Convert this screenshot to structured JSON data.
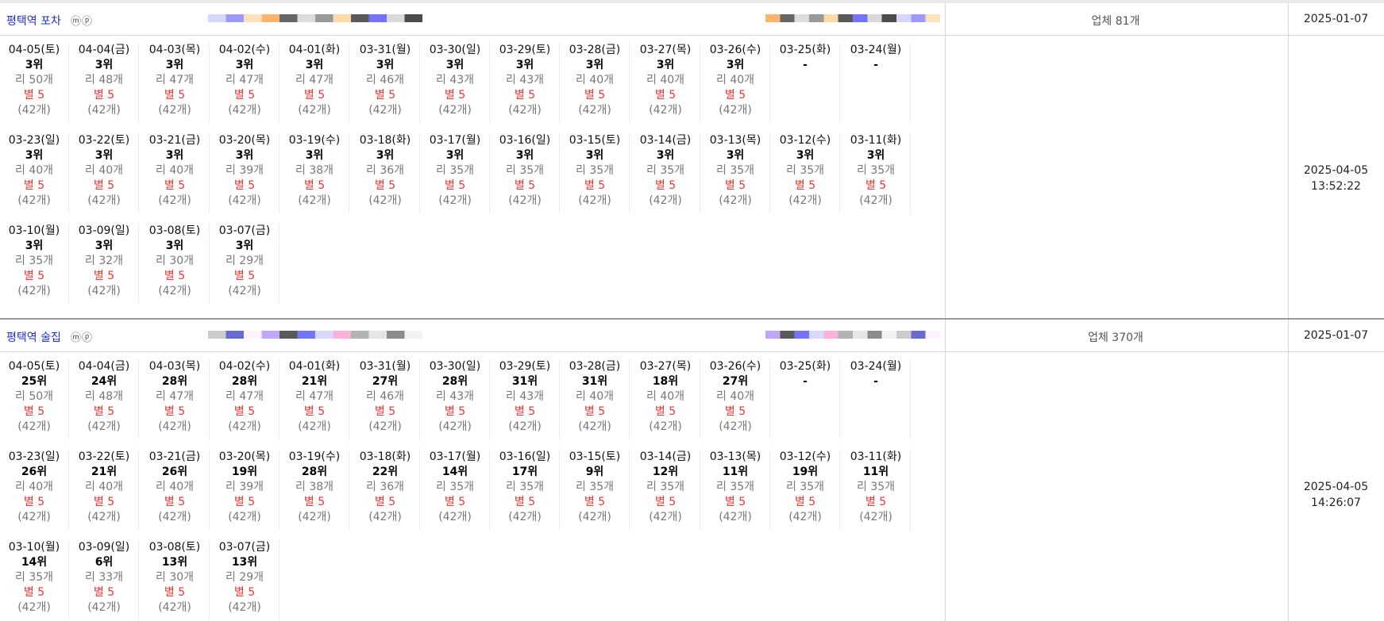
{
  "blocks": [
    {
      "keyword": "평택역 포차",
      "badges": "ⓜⓟ",
      "count_label": "업체 81개",
      "created_date": "2025-01-07",
      "updated_date": "2025-04-05",
      "updated_time": "13:52:22",
      "days": [
        {
          "date": "04-05(토)",
          "rank": "3위",
          "reviews": "리 50개",
          "star": "별 5",
          "star_count": "(42개)"
        },
        {
          "date": "04-04(금)",
          "rank": "3위",
          "reviews": "리 48개",
          "star": "별 5",
          "star_count": "(42개)"
        },
        {
          "date": "04-03(목)",
          "rank": "3위",
          "reviews": "리 47개",
          "star": "별 5",
          "star_count": "(42개)"
        },
        {
          "date": "04-02(수)",
          "rank": "3위",
          "reviews": "리 47개",
          "star": "별 5",
          "star_count": "(42개)"
        },
        {
          "date": "04-01(화)",
          "rank": "3위",
          "reviews": "리 47개",
          "star": "별 5",
          "star_count": "(42개)"
        },
        {
          "date": "03-31(월)",
          "rank": "3위",
          "reviews": "리 46개",
          "star": "별 5",
          "star_count": "(42개)"
        },
        {
          "date": "03-30(일)",
          "rank": "3위",
          "reviews": "리 43개",
          "star": "별 5",
          "star_count": "(42개)"
        },
        {
          "date": "03-29(토)",
          "rank": "3위",
          "reviews": "리 43개",
          "star": "별 5",
          "star_count": "(42개)"
        },
        {
          "date": "03-28(금)",
          "rank": "3위",
          "reviews": "리 40개",
          "star": "별 5",
          "star_count": "(42개)"
        },
        {
          "date": "03-27(목)",
          "rank": "3위",
          "reviews": "리 40개",
          "star": "별 5",
          "star_count": "(42개)"
        },
        {
          "date": "03-26(수)",
          "rank": "3위",
          "reviews": "리 40개",
          "star": "별 5",
          "star_count": "(42개)"
        },
        {
          "date": "03-25(화)",
          "rank": "-",
          "reviews": "",
          "star": "",
          "star_count": ""
        },
        {
          "date": "03-24(월)",
          "rank": "-",
          "reviews": "",
          "star": "",
          "star_count": ""
        },
        {
          "date": "03-23(일)",
          "rank": "3위",
          "reviews": "리 40개",
          "star": "별 5",
          "star_count": "(42개)"
        },
        {
          "date": "03-22(토)",
          "rank": "3위",
          "reviews": "리 40개",
          "star": "별 5",
          "star_count": "(42개)"
        },
        {
          "date": "03-21(금)",
          "rank": "3위",
          "reviews": "리 40개",
          "star": "별 5",
          "star_count": "(42개)"
        },
        {
          "date": "03-20(목)",
          "rank": "3위",
          "reviews": "리 39개",
          "star": "별 5",
          "star_count": "(42개)"
        },
        {
          "date": "03-19(수)",
          "rank": "3위",
          "reviews": "리 38개",
          "star": "별 5",
          "star_count": "(42개)"
        },
        {
          "date": "03-18(화)",
          "rank": "3위",
          "reviews": "리 36개",
          "star": "별 5",
          "star_count": "(42개)"
        },
        {
          "date": "03-17(월)",
          "rank": "3위",
          "reviews": "리 35개",
          "star": "별 5",
          "star_count": "(42개)"
        },
        {
          "date": "03-16(일)",
          "rank": "3위",
          "reviews": "리 35개",
          "star": "별 5",
          "star_count": "(42개)"
        },
        {
          "date": "03-15(토)",
          "rank": "3위",
          "reviews": "리 35개",
          "star": "별 5",
          "star_count": "(42개)"
        },
        {
          "date": "03-14(금)",
          "rank": "3위",
          "reviews": "리 35개",
          "star": "별 5",
          "star_count": "(42개)"
        },
        {
          "date": "03-13(목)",
          "rank": "3위",
          "reviews": "리 35개",
          "star": "별 5",
          "star_count": "(42개)"
        },
        {
          "date": "03-12(수)",
          "rank": "3위",
          "reviews": "리 35개",
          "star": "별 5",
          "star_count": "(42개)"
        },
        {
          "date": "03-11(화)",
          "rank": "3위",
          "reviews": "리 35개",
          "star": "별 5",
          "star_count": "(42개)"
        },
        {
          "date": "03-10(월)",
          "rank": "3위",
          "reviews": "리 35개",
          "star": "별 5",
          "star_count": "(42개)"
        },
        {
          "date": "03-09(일)",
          "rank": "3위",
          "reviews": "리 32개",
          "star": "별 5",
          "star_count": "(42개)"
        },
        {
          "date": "03-08(토)",
          "rank": "3위",
          "reviews": "리 30개",
          "star": "별 5",
          "star_count": "(42개)"
        },
        {
          "date": "03-07(금)",
          "rank": "3위",
          "reviews": "리 29개",
          "star": "별 5",
          "star_count": "(42개)"
        }
      ]
    },
    {
      "keyword": "평택역 술집",
      "badges": "ⓜⓟ",
      "count_label": "업체 370개",
      "created_date": "2025-01-07",
      "updated_date": "2025-04-05",
      "updated_time": "14:26:07",
      "days": [
        {
          "date": "04-05(토)",
          "rank": "25위",
          "reviews": "리 50개",
          "star": "별 5",
          "star_count": "(42개)"
        },
        {
          "date": "04-04(금)",
          "rank": "24위",
          "reviews": "리 48개",
          "star": "별 5",
          "star_count": "(42개)"
        },
        {
          "date": "04-03(목)",
          "rank": "28위",
          "reviews": "리 47개",
          "star": "별 5",
          "star_count": "(42개)"
        },
        {
          "date": "04-02(수)",
          "rank": "28위",
          "reviews": "리 47개",
          "star": "별 5",
          "star_count": "(42개)"
        },
        {
          "date": "04-01(화)",
          "rank": "21위",
          "reviews": "리 47개",
          "star": "별 5",
          "star_count": "(42개)"
        },
        {
          "date": "03-31(월)",
          "rank": "27위",
          "reviews": "리 46개",
          "star": "별 5",
          "star_count": "(42개)"
        },
        {
          "date": "03-30(일)",
          "rank": "28위",
          "reviews": "리 43개",
          "star": "별 5",
          "star_count": "(42개)"
        },
        {
          "date": "03-29(토)",
          "rank": "31위",
          "reviews": "리 43개",
          "star": "별 5",
          "star_count": "(42개)"
        },
        {
          "date": "03-28(금)",
          "rank": "31위",
          "reviews": "리 40개",
          "star": "별 5",
          "star_count": "(42개)"
        },
        {
          "date": "03-27(목)",
          "rank": "18위",
          "reviews": "리 40개",
          "star": "별 5",
          "star_count": "(42개)"
        },
        {
          "date": "03-26(수)",
          "rank": "27위",
          "reviews": "리 40개",
          "star": "별 5",
          "star_count": "(42개)"
        },
        {
          "date": "03-25(화)",
          "rank": "-",
          "reviews": "",
          "star": "",
          "star_count": ""
        },
        {
          "date": "03-24(월)",
          "rank": "-",
          "reviews": "",
          "star": "",
          "star_count": ""
        },
        {
          "date": "03-23(일)",
          "rank": "26위",
          "reviews": "리 40개",
          "star": "별 5",
          "star_count": "(42개)"
        },
        {
          "date": "03-22(토)",
          "rank": "21위",
          "reviews": "리 40개",
          "star": "별 5",
          "star_count": "(42개)"
        },
        {
          "date": "03-21(금)",
          "rank": "26위",
          "reviews": "리 40개",
          "star": "별 5",
          "star_count": "(42개)"
        },
        {
          "date": "03-20(목)",
          "rank": "19위",
          "reviews": "리 39개",
          "star": "별 5",
          "star_count": "(42개)"
        },
        {
          "date": "03-19(수)",
          "rank": "28위",
          "reviews": "리 38개",
          "star": "별 5",
          "star_count": "(42개)"
        },
        {
          "date": "03-18(화)",
          "rank": "22위",
          "reviews": "리 36개",
          "star": "별 5",
          "star_count": "(42개)"
        },
        {
          "date": "03-17(월)",
          "rank": "14위",
          "reviews": "리 35개",
          "star": "별 5",
          "star_count": "(42개)"
        },
        {
          "date": "03-16(일)",
          "rank": "17위",
          "reviews": "리 35개",
          "star": "별 5",
          "star_count": "(42개)"
        },
        {
          "date": "03-15(토)",
          "rank": "9위",
          "reviews": "리 35개",
          "star": "별 5",
          "star_count": "(42개)"
        },
        {
          "date": "03-14(금)",
          "rank": "12위",
          "reviews": "리 35개",
          "star": "별 5",
          "star_count": "(42개)"
        },
        {
          "date": "03-13(목)",
          "rank": "11위",
          "reviews": "리 35개",
          "star": "별 5",
          "star_count": "(42개)"
        },
        {
          "date": "03-12(수)",
          "rank": "19위",
          "reviews": "리 35개",
          "star": "별 5",
          "star_count": "(42개)"
        },
        {
          "date": "03-11(화)",
          "rank": "11위",
          "reviews": "리 35개",
          "star": "별 5",
          "star_count": "(42개)"
        },
        {
          "date": "03-10(월)",
          "rank": "14위",
          "reviews": "리 35개",
          "star": "별 5",
          "star_count": "(42개)"
        },
        {
          "date": "03-09(일)",
          "rank": "6위",
          "reviews": "리 33개",
          "star": "별 5",
          "star_count": "(42개)"
        },
        {
          "date": "03-08(토)",
          "rank": "13위",
          "reviews": "리 30개",
          "star": "별 5",
          "star_count": "(42개)"
        },
        {
          "date": "03-07(금)",
          "rank": "13위",
          "reviews": "리 29개",
          "star": "별 5",
          "star_count": "(42개)"
        }
      ]
    }
  ],
  "colors": {
    "keyword": "#1f2fcf",
    "star": "#e53935",
    "muted": "#777777"
  }
}
